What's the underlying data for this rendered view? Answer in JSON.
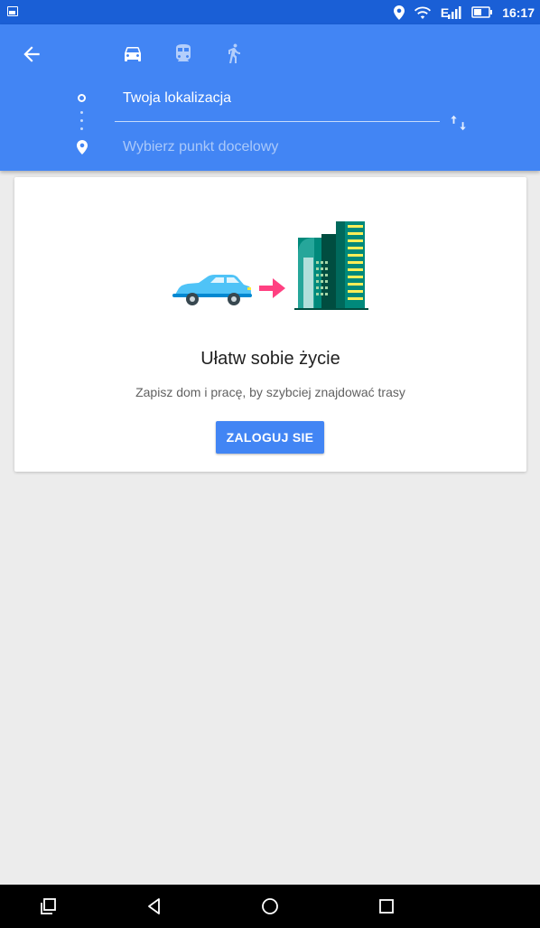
{
  "status_bar": {
    "time": "16:17",
    "network": "E",
    "icons": [
      "gallery-icon",
      "location-icon",
      "wifi-icon",
      "signal-icon",
      "battery-icon"
    ]
  },
  "header": {
    "modes": [
      "car-icon",
      "transit-icon",
      "walk-icon"
    ],
    "origin": "Twoja lokalizacja",
    "destination_placeholder": "Wybierz punkt docelowy"
  },
  "card": {
    "title": "Ułatw sobie życie",
    "subtitle": "Zapisz dom i pracę, by szybciej znajdować trasy",
    "button": "ZALOGUJ SIE"
  },
  "colors": {
    "status_bar": "#1a5fd6",
    "header": "#4285f4",
    "background": "#ececec",
    "button": "#4285f4"
  }
}
